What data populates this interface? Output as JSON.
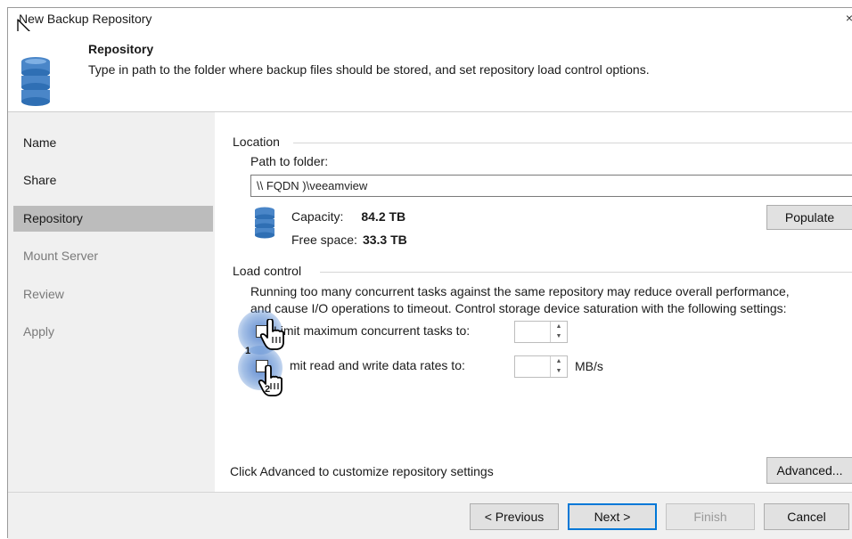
{
  "window": {
    "title": "New Backup Repository",
    "close_glyph": "×"
  },
  "header": {
    "title": "Repository",
    "subtitle": "Type in path to the folder where backup files should be stored, and set repository load control options."
  },
  "sidebar": {
    "items": [
      {
        "label": "Name",
        "state": "normal"
      },
      {
        "label": "Share",
        "state": "normal"
      },
      {
        "label": "Repository",
        "state": "active"
      },
      {
        "label": "Mount Server",
        "state": "disabled"
      },
      {
        "label": "Review",
        "state": "disabled"
      },
      {
        "label": "Apply",
        "state": "disabled"
      }
    ]
  },
  "location": {
    "group_label": "Location",
    "path_label": "Path to folder:",
    "path_value": "\\\\   FQDN   )\\veeamview",
    "capacity_label": "Capacity:",
    "capacity_value": "84.2 TB",
    "free_label": "Free space:",
    "free_value": "33.3 TB",
    "populate_label": "Populate"
  },
  "load_control": {
    "group_label": "Load control",
    "description_line1": "Running too many concurrent tasks against the same repository may reduce overall performance,",
    "description_line2": "and cause I/O operations to timeout. Control storage device saturation with the following settings:",
    "limit_tasks_label": "Limit maximum concurrent tasks to:",
    "limit_tasks_checked": false,
    "limit_rate_label": "mit read and write data rates to:",
    "limit_rate_checked": false,
    "rate_unit": "MB/s",
    "callouts": [
      "1",
      "2"
    ]
  },
  "advanced": {
    "hint": "Click Advanced to customize repository settings",
    "button_label": "Advanced..."
  },
  "footer": {
    "previous_label": "< Previous",
    "next_label": "Next >",
    "finish_label": "Finish",
    "cancel_label": "Cancel"
  },
  "icons": {
    "database": "database-icon",
    "cursor": "mouse-pointer-icon",
    "hand": "hand-pointer-icon"
  },
  "colors": {
    "accent": "#0078d7",
    "db_blue": "#4a86c8",
    "sidebar_bg": "#f0f0f0",
    "active_bg": "#bcbcbc"
  }
}
